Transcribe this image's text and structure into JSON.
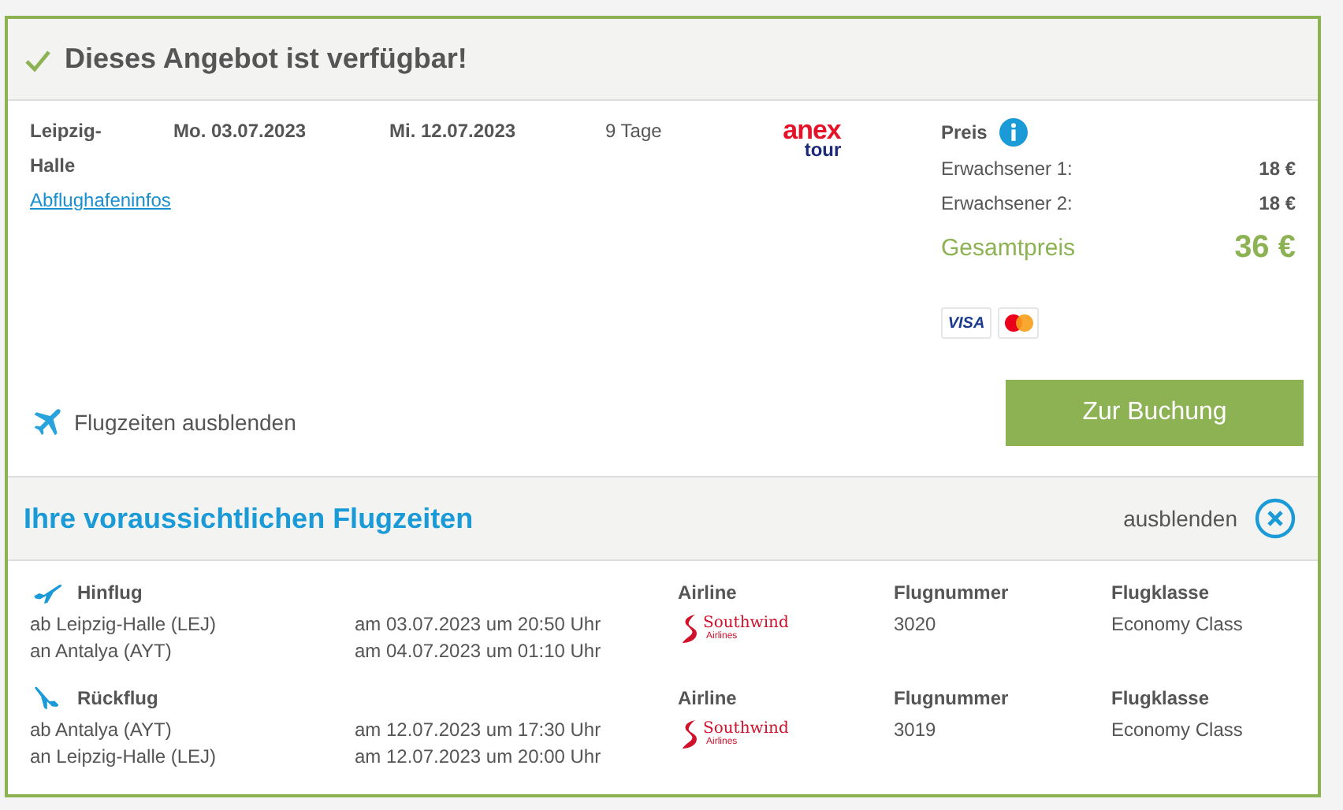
{
  "header": {
    "title": "Dieses Angebot ist verfügbar!"
  },
  "offer": {
    "departure_airport": "Leipzig-Halle",
    "airport_link": "Abflughafeninfos",
    "outbound_date": "Mo. 03.07.2023",
    "return_date": "Mi. 12.07.2023",
    "duration": "9 Tage",
    "operator_logo": {
      "line_1": "anex",
      "line_2": "tour"
    },
    "toggle_link": "Flugzeiten ausblenden"
  },
  "price": {
    "label": "Preis",
    "lines": [
      {
        "label": "Erwachsener 1:",
        "amount": "18 €"
      },
      {
        "label": "Erwachsener 2:",
        "amount": "18 €"
      }
    ],
    "total_label": "Gesamtpreis",
    "total": "36 €",
    "payment_methods": [
      {
        "kind": "visa",
        "text": "VISA"
      },
      {
        "kind": "mastercard"
      }
    ],
    "book_button": "Zur Buchung"
  },
  "flight_times": {
    "title": "Ihre voraussichtlichen Flugzeiten",
    "hide_label": "ausblenden",
    "legs": [
      {
        "kind": "outbound",
        "label": "Hinflug",
        "from": "ab Leipzig-Halle (LEJ)",
        "depart": "am 03.07.2023 um 20:50 Uhr",
        "to": "an Antalya (AYT)",
        "arrive": "am 04.07.2023 um 01:10 Uhr",
        "airline_heading": "Airline",
        "airline_logo": {
          "name": "Southwind",
          "sub": "Airlines"
        },
        "number_heading": "Flugnummer",
        "number": "3020",
        "class_heading": "Flugklasse",
        "class": "Economy Class"
      },
      {
        "kind": "return",
        "label": "Rückflug",
        "from": "ab Antalya (AYT)",
        "depart": "am 12.07.2023 um 17:30 Uhr",
        "to": "an Leipzig-Halle (LEJ)",
        "arrive": "am 12.07.2023 um 20:00 Uhr",
        "airline_heading": "Airline",
        "airline_logo": {
          "name": "Southwind",
          "sub": "Airlines"
        },
        "number_heading": "Flugnummer",
        "number": "3019",
        "class_heading": "Flugklasse",
        "class": "Economy Class"
      }
    ]
  }
}
